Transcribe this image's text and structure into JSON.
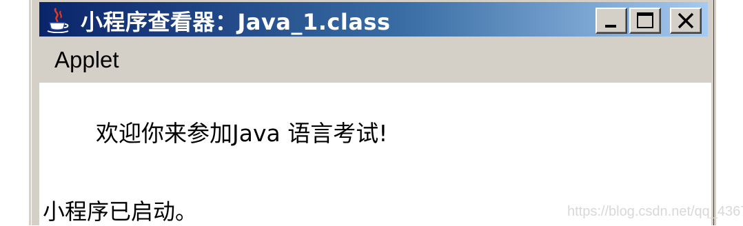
{
  "window": {
    "title": "小程序查看器：Java_1.class",
    "app_icon": "java-coffee-cup-icon",
    "controls": {
      "minimize": "minimize-icon",
      "maximize": "maximize-icon",
      "close": "close-icon"
    },
    "colors": {
      "titlebar_start": "#0a246a",
      "titlebar_end": "#a6caf0",
      "chrome": "#d4d0c8"
    }
  },
  "menubar": {
    "items": [
      {
        "label": "Applet"
      }
    ]
  },
  "content": {
    "message": "欢迎你来参加Java 语言考试!"
  },
  "status": {
    "text": "小程序已启动。"
  },
  "watermark": {
    "text": "https://blog.csdn.net/qq_43674360"
  }
}
